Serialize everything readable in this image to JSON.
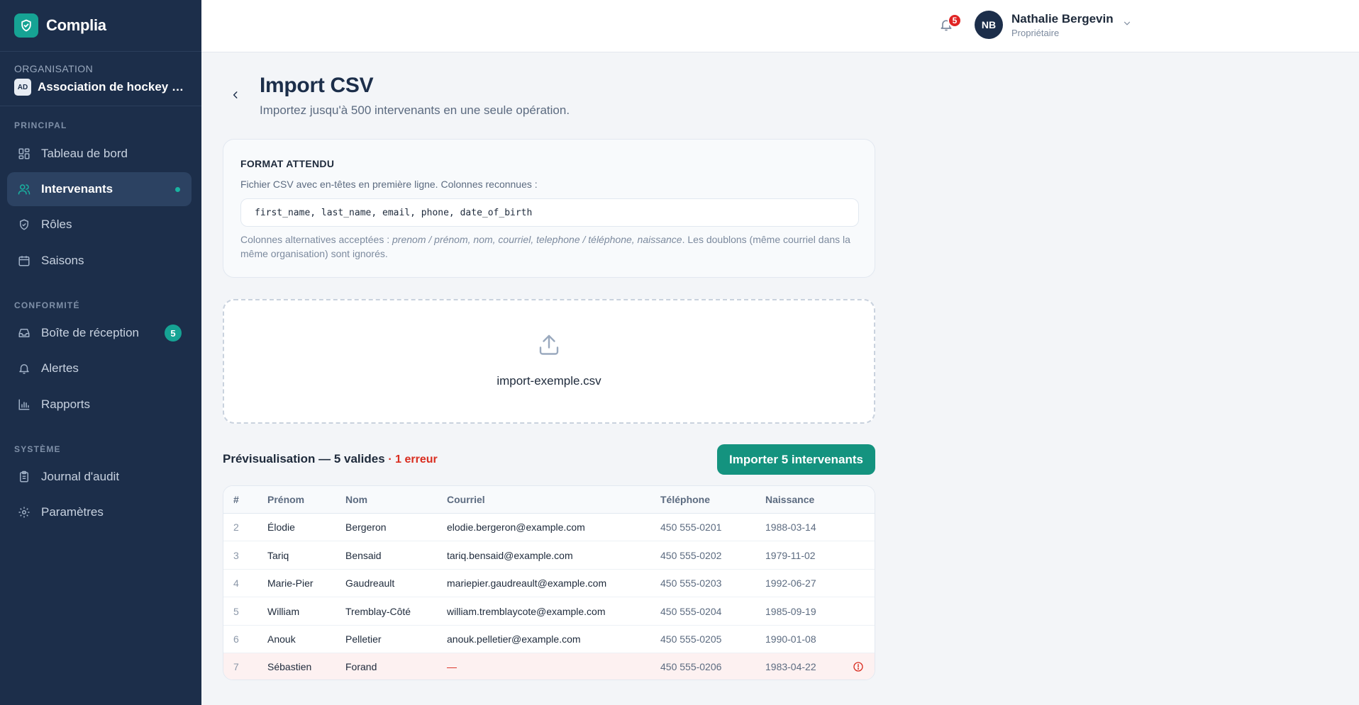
{
  "app": {
    "name": "Complia"
  },
  "org": {
    "label": "ORGANISATION",
    "avatar": "AD",
    "name": "Association de hockey mineur"
  },
  "sidebar": {
    "sections": [
      {
        "label": "PRINCIPAL"
      },
      {
        "label": "CONFORMITÉ"
      },
      {
        "label": "SYSTÈME"
      }
    ],
    "items": [
      {
        "label": "Tableau de bord",
        "icon": "dashboard-icon"
      },
      {
        "label": "Intervenants",
        "icon": "users-icon",
        "active": true
      },
      {
        "label": "Rôles",
        "icon": "shield-icon"
      },
      {
        "label": "Saisons",
        "icon": "calendar-icon"
      },
      {
        "label": "Boîte de réception",
        "icon": "inbox-icon",
        "badge": "5"
      },
      {
        "label": "Alertes",
        "icon": "bell-icon"
      },
      {
        "label": "Rapports",
        "icon": "bar-chart-icon"
      },
      {
        "label": "Journal d'audit",
        "icon": "clipboard-icon"
      },
      {
        "label": "Paramètres",
        "icon": "gear-icon"
      }
    ]
  },
  "topbar": {
    "notifications": "5",
    "user": {
      "initials": "NB",
      "name": "Nathalie Bergevin",
      "role": "Propriétaire"
    }
  },
  "page": {
    "title": "Import CSV",
    "subtitle": "Importez jusqu'à 500 intervenants en une seule opération."
  },
  "format": {
    "title": "FORMAT ATTENDU",
    "description": "Fichier CSV avec en-têtes en première ligne. Colonnes reconnues :",
    "columns": "first_name, last_name, email, phone, date_of_birth",
    "note_prefix": "Colonnes alternatives acceptées : ",
    "note_alternatives": "prenom / prénom, nom, courriel, telephone / téléphone, naissance",
    "note_suffix": ". Les doublons (même courriel dans la même organisation) sont ignorés."
  },
  "dropzone": {
    "file_name": "import-exemple.csv"
  },
  "preview": {
    "title": "Prévisualisation — 5 valides",
    "error_text": "· 1 erreur",
    "import_button": "Importer 5 intervenants",
    "headers": [
      "#",
      "Prénom",
      "Nom",
      "Courriel",
      "Téléphone",
      "Naissance"
    ],
    "rows": [
      {
        "num": "2",
        "first": "Élodie",
        "last": "Bergeron",
        "email": "elodie.bergeron@example.com",
        "phone": "450 555-0201",
        "dob": "1988-03-14"
      },
      {
        "num": "3",
        "first": "Tariq",
        "last": "Bensaid",
        "email": "tariq.bensaid@example.com",
        "phone": "450 555-0202",
        "dob": "1979-11-02"
      },
      {
        "num": "4",
        "first": "Marie-Pier",
        "last": "Gaudreault",
        "email": "mariepier.gaudreault@example.com",
        "phone": "450 555-0203",
        "dob": "1992-06-27"
      },
      {
        "num": "5",
        "first": "William",
        "last": "Tremblay-Côté",
        "email": "william.tremblaycote@example.com",
        "phone": "450 555-0204",
        "dob": "1985-09-19"
      },
      {
        "num": "6",
        "first": "Anouk",
        "last": "Pelletier",
        "email": "anouk.pelletier@example.com",
        "phone": "450 555-0205",
        "dob": "1990-01-08"
      },
      {
        "num": "7",
        "first": "Sébastien",
        "last": "Forand",
        "email": "—",
        "phone": "450 555-0206",
        "dob": "1983-04-22",
        "error": true
      }
    ]
  },
  "colors": {
    "sidebar_bg": "#1c2e4a",
    "accent": "#16a394",
    "error": "#d92d20"
  }
}
